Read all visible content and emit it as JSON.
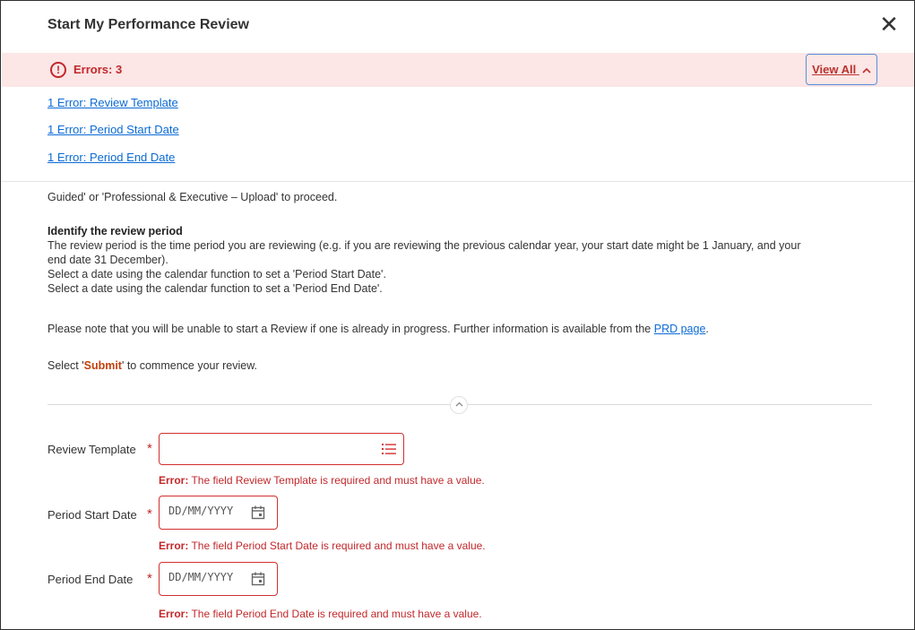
{
  "dialog": {
    "title": "Start My Performance Review",
    "close_glyph": "✕"
  },
  "errors": {
    "summary_label": "Errors: 3",
    "view_all_label": "View All",
    "view_all_chevron": "^",
    "links": [
      "1 Error: Review Template",
      "1 Error: Period Start Date",
      "1 Error: Period End Date"
    ]
  },
  "instructions": {
    "partial_line": "Guided' or 'Professional & Executive – Upload' to proceed.",
    "section_heading": "Identify the review period",
    "period_line1": "The review period is the time period you are reviewing (e.g. if you are reviewing the previous calendar year, your start date might be 1 January, and your",
    "period_line2": "end date 31 December).",
    "start_line": "Select a date using the calendar function to set a 'Period Start Date'.",
    "end_line": "Select a date using the calendar function to set a 'Period End Date'.",
    "note_prefix": "Please note that you will be unable to start a Review if one is already in progress. Further information is available from the ",
    "note_link": "PRD page",
    "note_suffix": ".",
    "submit_prefix": "Select '",
    "submit_word": "Submit",
    "submit_suffix": "' to commence your review."
  },
  "form": {
    "required_marker": "*",
    "review_template": {
      "label": "Review Template",
      "value": "",
      "error_prefix": "Error:",
      "error_text": " The field Review Template is required and must have a value."
    },
    "period_start": {
      "label": "Period Start Date",
      "placeholder": "DD/MM/YYYY",
      "error_prefix": "Error:",
      "error_text": " The field Period Start Date is required and must have a value."
    },
    "period_end": {
      "label": "Period End Date",
      "placeholder": "DD/MM/YYYY",
      "error_prefix": "Error:",
      "error_text": " The field Period End Date is required and must have a value."
    }
  },
  "colors": {
    "error_red": "#c2282b",
    "error_banner_bg": "#fce6e6",
    "link_blue": "#0b6bd5",
    "submit_orange": "#c2410c"
  }
}
